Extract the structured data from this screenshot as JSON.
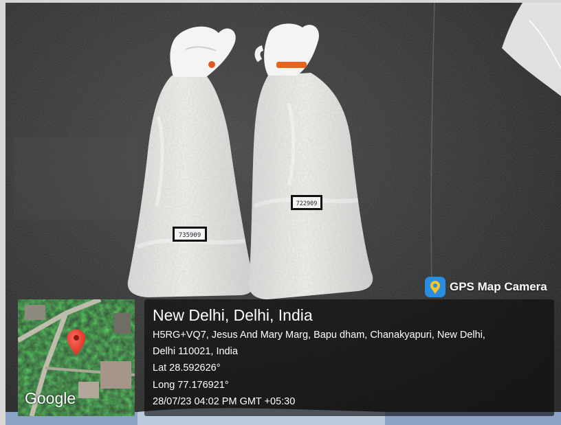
{
  "badge": {
    "app_name": "GPS Map Camera",
    "icon": "gps-map-camera-icon"
  },
  "map": {
    "provider_logo": "Google",
    "marker_icon": "map-pin-icon",
    "marker_color": "#e8372c"
  },
  "location": {
    "city": "New Delhi, Delhi, India",
    "address_line1": "H5RG+VQ7, Jesus And Mary Marg, Bapu dham, Chanakyapuri, New Delhi,",
    "address_line2": "Delhi 110021, India",
    "lat": "Lat 28.592626°",
    "long": "Long 77.176921°",
    "timestamp": "28/07/23 04:02 PM GMT +05:30"
  },
  "bag_labels": [
    "735909",
    "722909"
  ]
}
